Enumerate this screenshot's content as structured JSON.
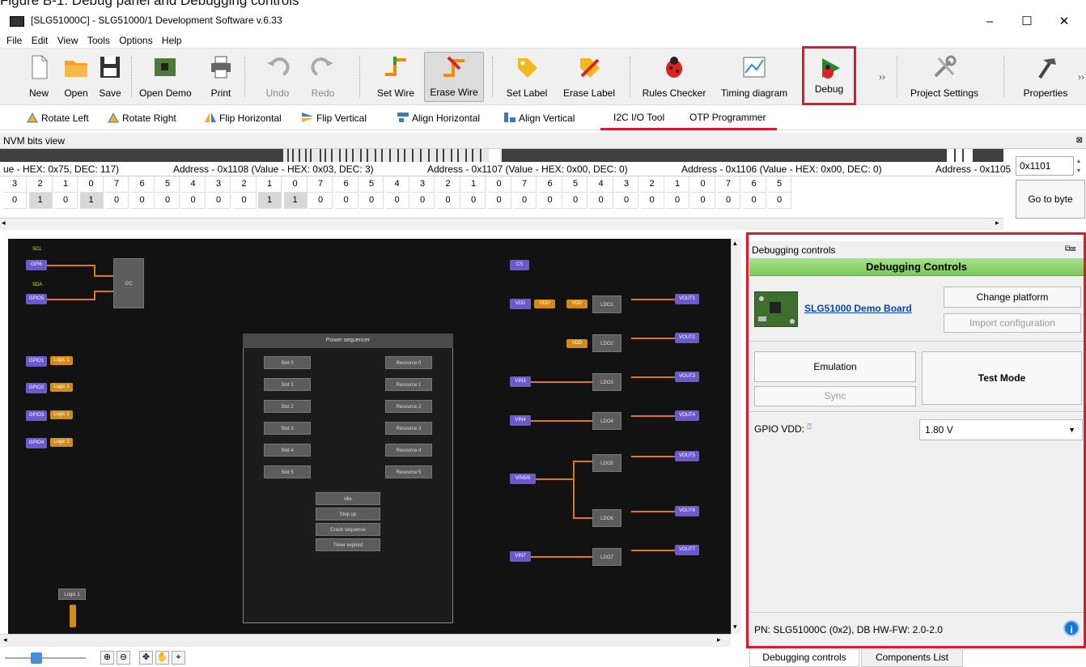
{
  "caption": "Figure B-1: Debug panel and Debugging controls",
  "window": {
    "title": "[SLG51000C] - SLG51000/1 Development Software v.6.33",
    "min": "–",
    "max": "☐",
    "close": "✕"
  },
  "menu": [
    "File",
    "Edit",
    "View",
    "Tools",
    "Options",
    "Help"
  ],
  "toolbar": {
    "new": "New",
    "open": "Open",
    "save": "Save",
    "open_demo": "Open Demo",
    "print": "Print",
    "undo": "Undo",
    "redo": "Redo",
    "set_wire": "Set Wire",
    "erase_wire": "Erase Wire",
    "set_label": "Set Label",
    "erase_label": "Erase Label",
    "rules_checker": "Rules Checker",
    "timing_diagram": "Timing diagram",
    "debug": "Debug",
    "more": "››",
    "project_settings": "Project Settings",
    "properties": "Properties",
    "more2": "››"
  },
  "subtoolbar": {
    "rotate_left": "Rotate Left",
    "rotate_right": "Rotate Right",
    "flip_horizontal": "Flip Horizontal",
    "flip_vertical": "Flip Vertical",
    "align_horizontal": "Align Horizontal",
    "align_vertical": "Align Vertical",
    "i2c_tool": "I2C I/O Tool",
    "otp_programmer": "OTP Programmer"
  },
  "nvm": {
    "title": "NVM bits view",
    "addresses": [
      "ue - HEX: 0x75, DEC: 117)",
      "Address - 0x1108 (Value - HEX: 0x03, DEC: 3)",
      "Address - 0x1107 (Value - HEX: 0x00, DEC: 0)",
      "Address - 0x1106 (Value - HEX: 0x00, DEC: 0)",
      "Address - 0x1105"
    ],
    "bit_index": [
      "3",
      "2",
      "1",
      "0",
      "7",
      "6",
      "5",
      "4",
      "3",
      "2",
      "1",
      "0",
      "7",
      "6",
      "5",
      "4",
      "3",
      "2",
      "1",
      "0",
      "7",
      "6",
      "5",
      "4",
      "3",
      "2",
      "1",
      "0",
      "7",
      "6",
      "5"
    ],
    "bit_values": [
      "0",
      "1",
      "0",
      "1",
      "0",
      "0",
      "0",
      "0",
      "0",
      "0",
      "1",
      "1",
      "0",
      "0",
      "0",
      "0",
      "0",
      "0",
      "0",
      "0",
      "0",
      "0",
      "0",
      "0",
      "0",
      "0",
      "0",
      "0",
      "0",
      "0",
      "0"
    ],
    "address_input": "0x1101",
    "go_to_byte": "Go to byte"
  },
  "canvas": {
    "scl": "SCL",
    "sda": "SDA",
    "gpi6": "GPI6",
    "gpio5": "GPIO5",
    "i2c": "I2C",
    "gpio1": "GPIO1",
    "gpio2": "GPIO2",
    "gpio3": "GPIO3",
    "gpio4": "GPIO4",
    "logic1": "Logic 1",
    "cs": "CS",
    "vdd": "VDD",
    "vin3": "VIN3",
    "vin4": "VIN4",
    "vin56": "VIN5/6",
    "vin7": "VIN7",
    "ldos": [
      "LDO1",
      "LDO2",
      "LDO3",
      "LDO4",
      "LDO5",
      "LDO6",
      "LDO7"
    ],
    "vouts": [
      "VOUT1",
      "VOUT2",
      "VOUT3",
      "VOUT4",
      "VOUT5",
      "VOUT6",
      "VOUT7"
    ],
    "power_sequencer": "Power sequencer",
    "slots": [
      "Slot 0",
      "Slot 1",
      "Slot 2",
      "Slot 3",
      "Slot 4",
      "Slot 5"
    ],
    "resources": [
      "Resource 0",
      "Resource 1",
      "Resource 2",
      "Resource 3",
      "Resource 4",
      "Resource 5"
    ],
    "states": [
      "Idle",
      "Step up",
      "Crash sequence",
      "Timer expired"
    ],
    "logic_bottom": "Logic 1"
  },
  "panel": {
    "title": "Debugging controls",
    "banner": "Debugging Controls",
    "board_link": "SLG51000 Demo Board",
    "change_platform": "Change platform",
    "import_configuration": "Import configuration",
    "emulation": "Emulation",
    "test_mode": "Test Mode",
    "sync": "Sync",
    "gpio_vdd_label": "GPIO VDD:",
    "gpio_vdd_value": "1.80 V",
    "pn": "PN: SLG51000C (0x2), DB HW-FW: 2.0-2.0",
    "info": "i",
    "tabs": [
      "Debugging controls",
      "Components List"
    ]
  },
  "colors": {
    "highlight": "#e0162b",
    "banner": "#8fd46f",
    "link": "#0645ad",
    "node": "#6a5acd",
    "wire": "#e07a10"
  }
}
